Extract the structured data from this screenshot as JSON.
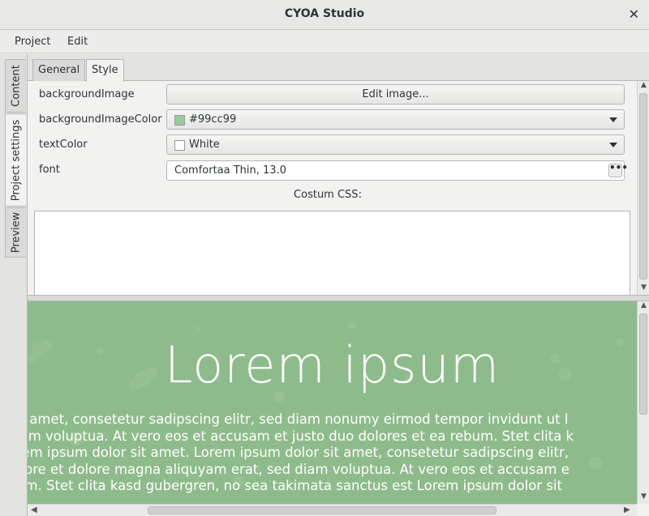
{
  "window": {
    "title": "CYOA Studio",
    "close_glyph": "✕"
  },
  "menu": {
    "items": [
      "Project",
      "Edit"
    ]
  },
  "side_tabs": [
    "Content",
    "Project settings",
    "Preview"
  ],
  "sub_tabs": [
    "General",
    "Style"
  ],
  "form": {
    "background_image": {
      "label": "backgroundImage",
      "button": "Edit image..."
    },
    "background_image_color": {
      "label": "backgroundImageColor",
      "value": "#99cc99",
      "swatch": "#99cc99"
    },
    "text_color": {
      "label": "textColor",
      "value": "White",
      "swatch": "#ffffff"
    },
    "font": {
      "label": "font",
      "value": "Comfortaa Thin, 13.0",
      "more": "•••"
    }
  },
  "custom_css": {
    "label": "Costum CSS:",
    "value": ""
  },
  "preview": {
    "title": "Lorem ipsum",
    "lines": [
      "it amet, consetetur sadipscing elitr, sed diam nonumy eirmod tempor invidunt ut l",
      "iam voluptua. At vero eos et accusam et justo duo dolores et ea rebum. Stet clita k",
      "rem ipsum dolor sit amet. Lorem ipsum dolor sit amet, consetetur sadipscing elitr,",
      "oore et dolore magna aliquyam erat, sed diam voluptua. At vero eos et accusam e",
      "um. Stet clita kasd gubergren, no sea takimata sanctus est Lorem ipsum dolor sit"
    ],
    "background": "#8ebb8b",
    "text_color": "#ffffff"
  },
  "icons": {
    "close": "close-icon",
    "dropdown": "chevron-down-icon",
    "more": "ellipsis-icon",
    "swatch": "color-swatch-icon"
  }
}
